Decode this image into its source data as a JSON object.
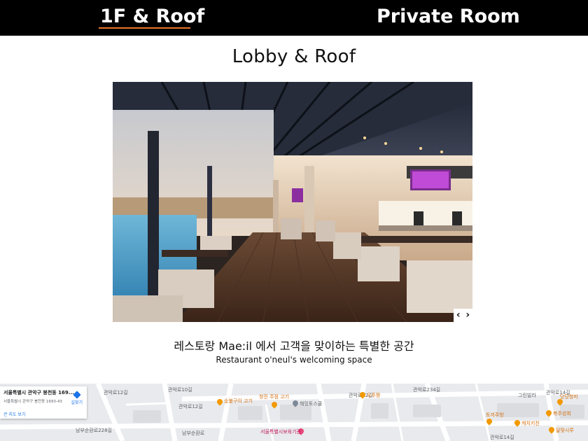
{
  "nav": {
    "tab_1f_roof": "1F & Roof",
    "tab_private_room": "Private Room",
    "active_tab": "1F & Roof",
    "accent_color": "#e8742a"
  },
  "section": {
    "title": "Lobby & Roof"
  },
  "gallery": {
    "prev_label": "‹",
    "next_label": "›",
    "prev_icon": "chevron-left-icon",
    "next_icon": "chevron-right-icon"
  },
  "caption": {
    "korean": "레스토랑 Mae:il 에서 고객을 맞이하는 특별한 공간",
    "english": "Restaurant o'neul's welcoming space"
  },
  "map": {
    "card_address_title": "서울특별시 관악구 봉천동 169...",
    "card_address_detail": "서울특별시 관악구 봉천동 1693-43",
    "card_directions": "길찾기",
    "card_bigger_map": "큰 지도 보기",
    "street_labels": [
      "관악로12길",
      "관악로10길",
      "관악로12길",
      "관악로12길",
      "관악로234길",
      "남부순환로228길",
      "남부순환로",
      "관악로14길",
      "관악로14길"
    ],
    "pois": [
      "숯불구이 고기",
      "청진 주점 고기",
      "해밍토스쿨",
      "우주짱",
      "서울특별시보육기관",
      "당당청미",
      "토끼주방",
      "캐치키친",
      "복주성회",
      "달맞시루",
      "그린빌라"
    ]
  }
}
